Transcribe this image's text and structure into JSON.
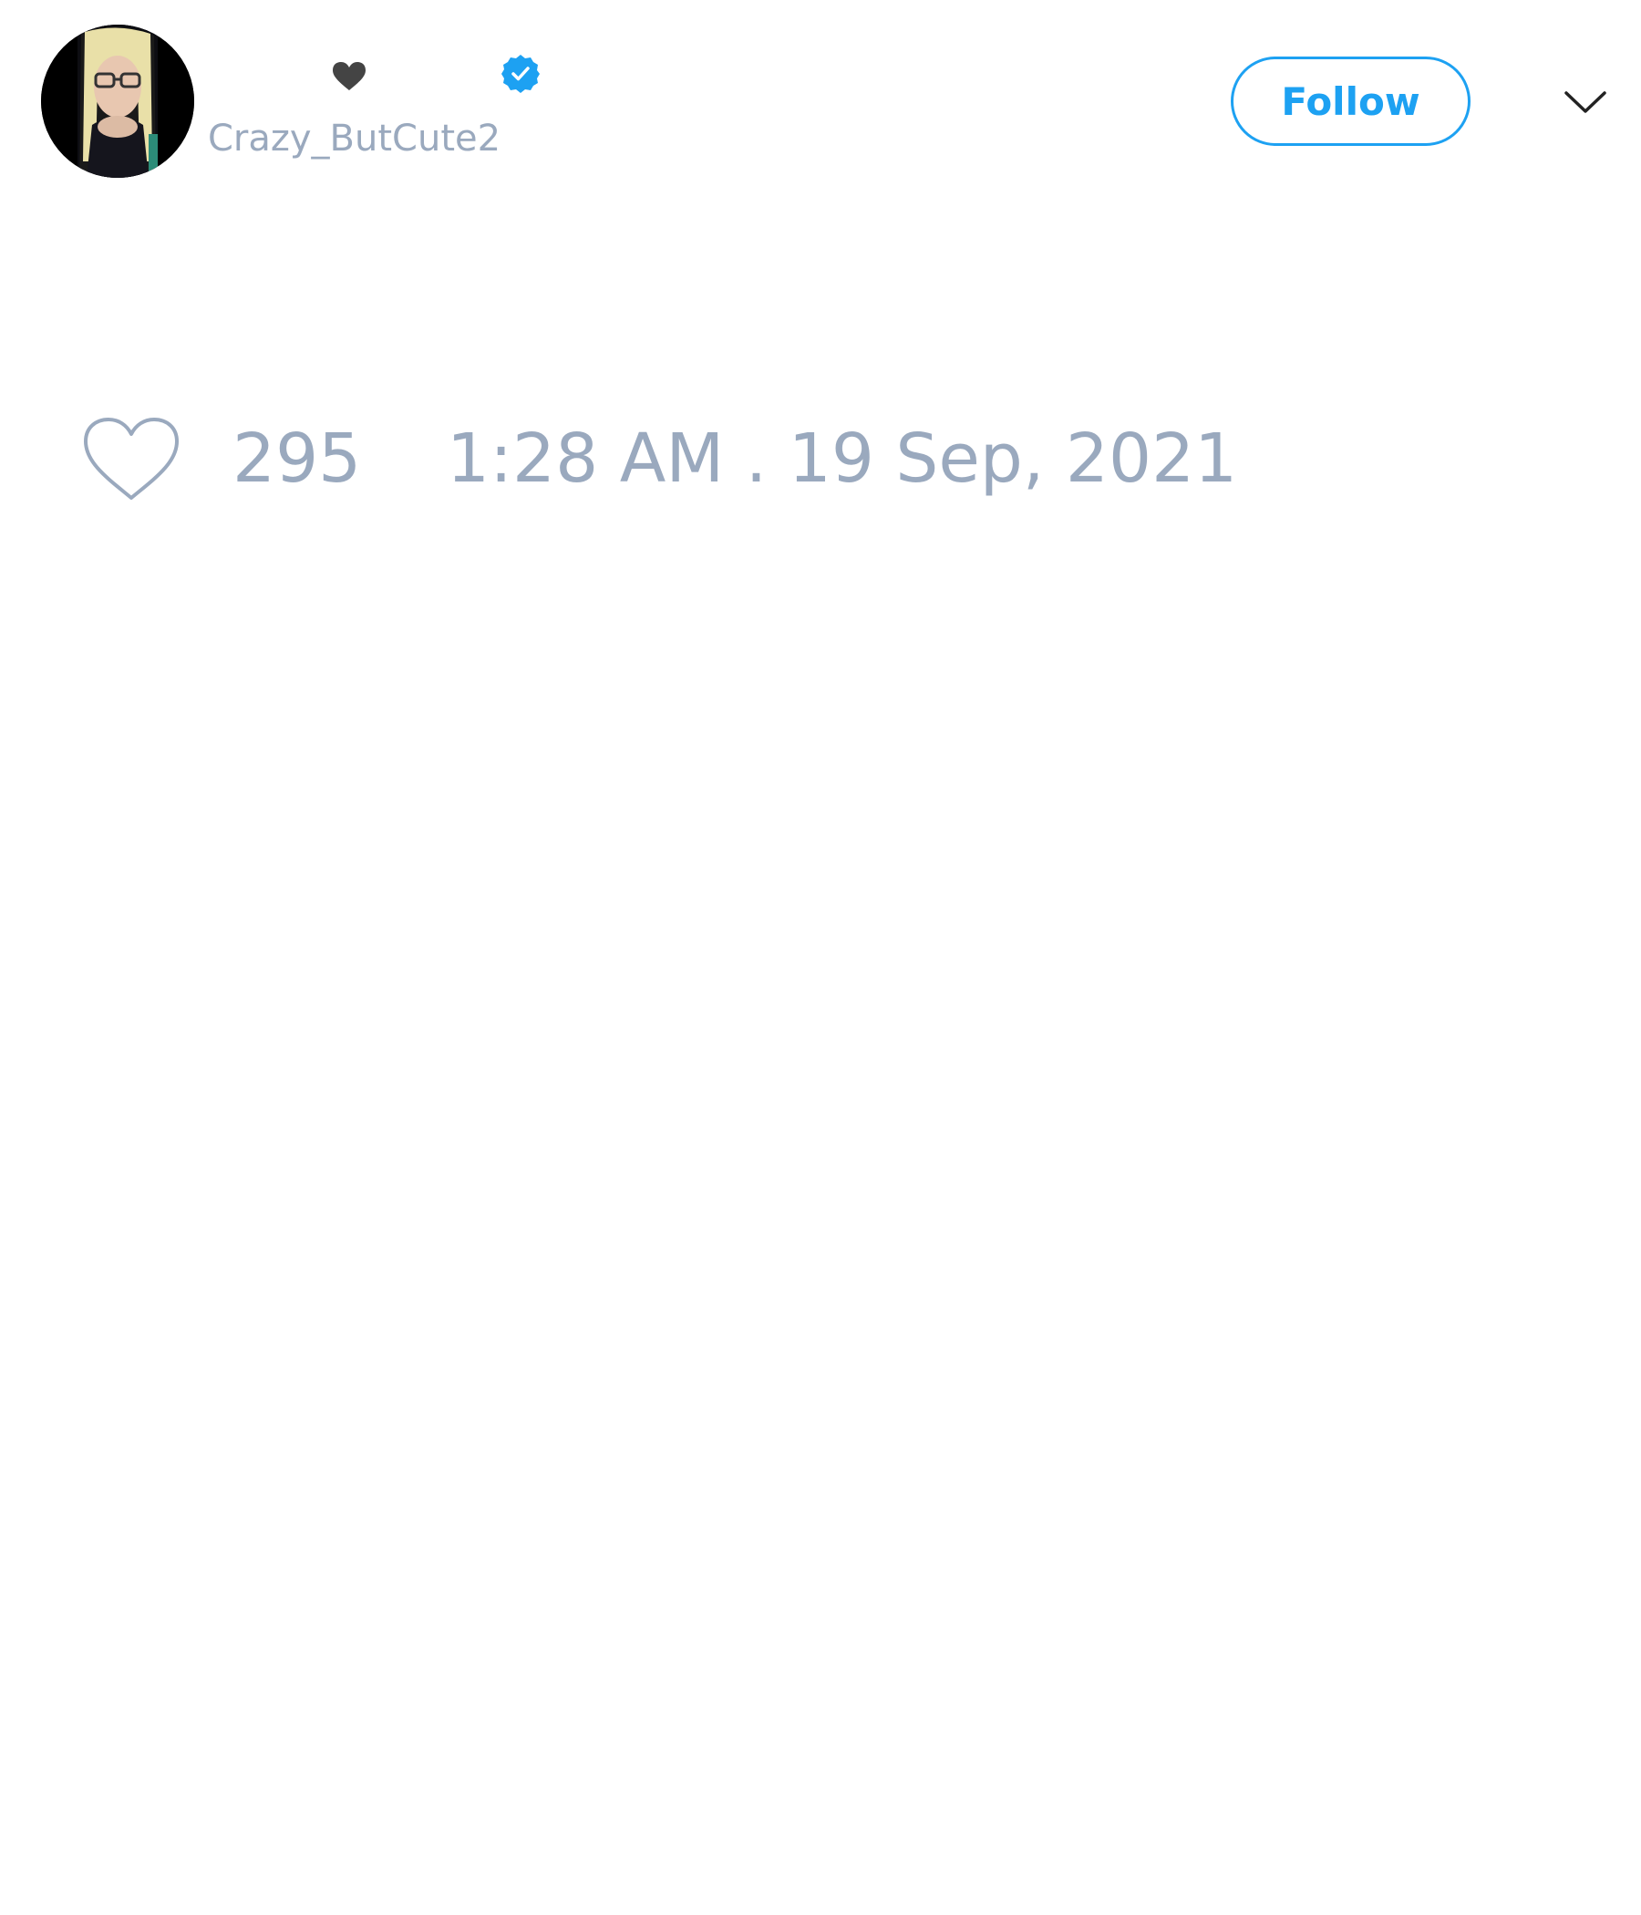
{
  "tweet": {
    "author": {
      "handle": "Crazy_ButCute2",
      "name_emoji": "black-heart",
      "verified": true
    },
    "follow_label": "Follow",
    "like_count": "295",
    "timestamp": "1:28 AM . 19 Sep, 2021"
  },
  "icons": {
    "like": "heart-outline-icon",
    "menu": "chevron-down-icon",
    "verified": "verified-badge-icon"
  },
  "colors": {
    "accent": "#1da1f2",
    "muted_text": "#9aa9be",
    "heart_emoji": "#444444"
  }
}
